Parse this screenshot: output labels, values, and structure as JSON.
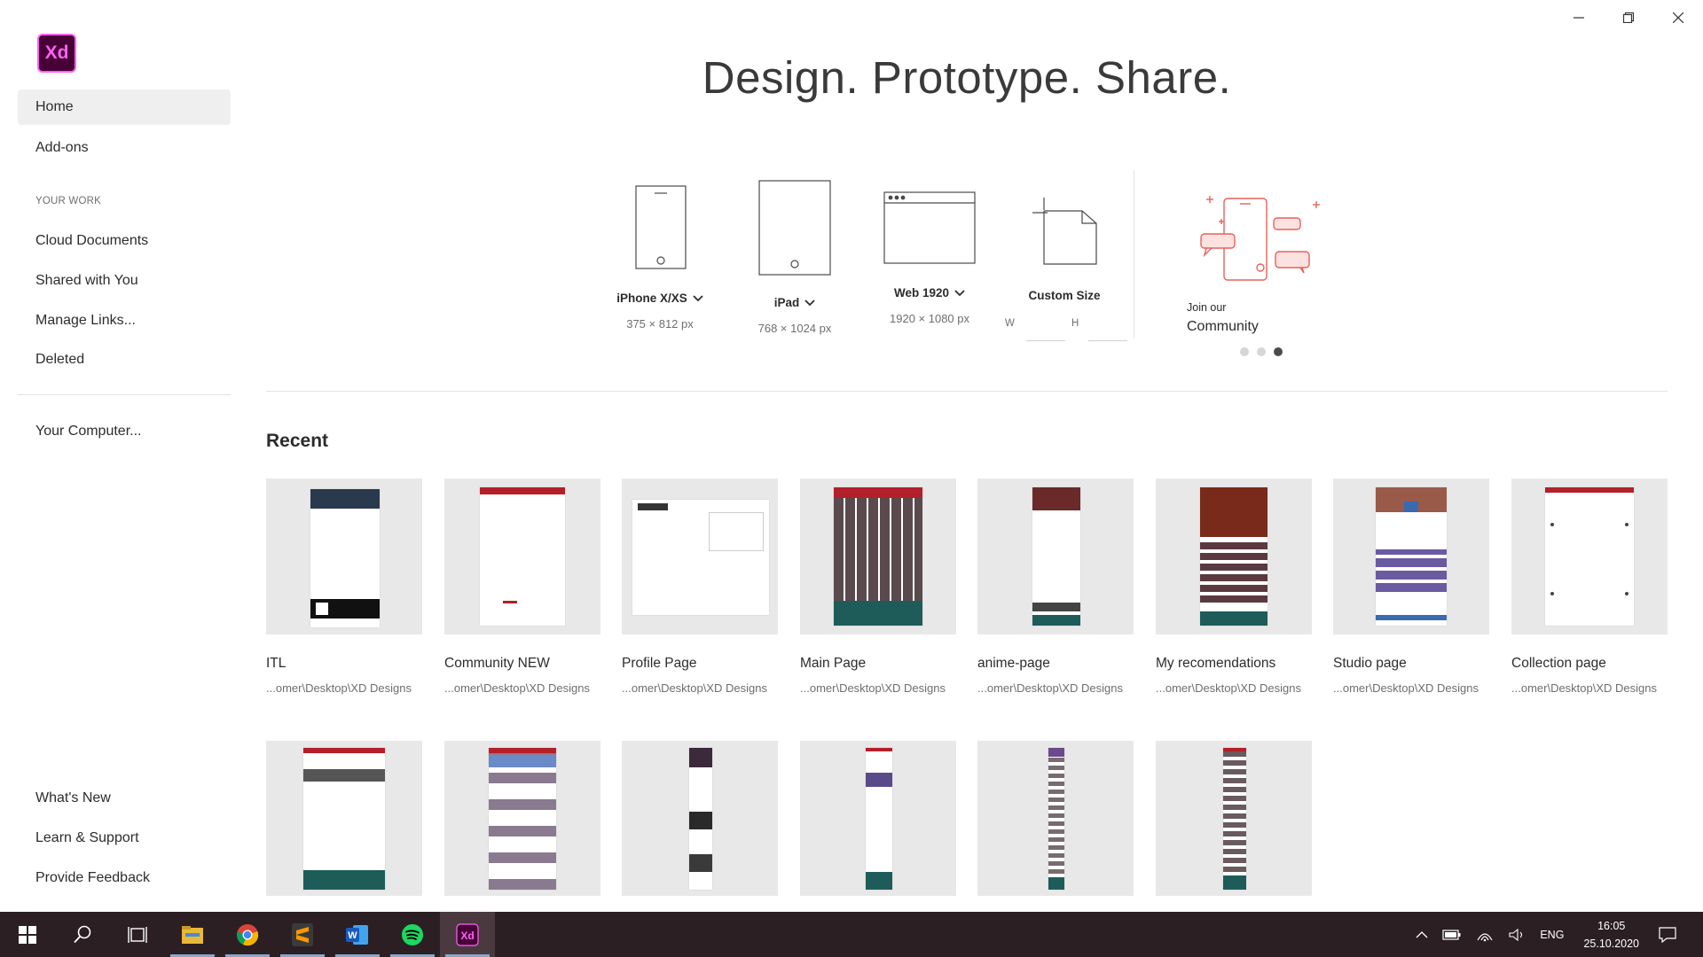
{
  "app": {
    "logo_text": "Xd",
    "brand_color": "#ff61f6",
    "brand_bg": "#470137"
  },
  "window_controls": [
    "minimize-icon",
    "restore-icon",
    "close-icon"
  ],
  "sidebar": {
    "items_top": [
      {
        "label": "Home",
        "active": true
      },
      {
        "label": "Add-ons"
      }
    ],
    "section_label": "YOUR WORK",
    "items_work": [
      {
        "label": "Cloud Documents"
      },
      {
        "label": "Shared with You"
      },
      {
        "label": "Manage Links..."
      },
      {
        "label": "Deleted"
      }
    ],
    "computer": "Your Computer...",
    "items_bottom": [
      {
        "label": "What's New"
      },
      {
        "label": "Learn & Support"
      },
      {
        "label": "Provide Feedback"
      }
    ]
  },
  "hero": {
    "title": "Design. Prototype. Share."
  },
  "presets": [
    {
      "name": "iPhone X/XS",
      "dims": "375 × 812 px",
      "icon": "phone-icon"
    },
    {
      "name": "iPad",
      "dims": "768 × 1024 px",
      "icon": "tablet-icon"
    },
    {
      "name": "Web 1920",
      "dims": "1920 × 1080 px",
      "icon": "browser-window-icon"
    }
  ],
  "custom_size": {
    "name": "Custom Size",
    "w_label": "W",
    "h_label": "H",
    "w_value": "",
    "h_value": ""
  },
  "community": {
    "small": "Join our",
    "big": "Community",
    "accent": "#e8605a"
  },
  "carousel": {
    "count": 3,
    "active": 3
  },
  "recent": {
    "title": "Recent",
    "cards": [
      {
        "title": "ITL",
        "path": "...omer\\Desktop\\XD Designs"
      },
      {
        "title": "Community NEW",
        "path": "...omer\\Desktop\\XD Designs"
      },
      {
        "title": "Profile Page",
        "path": "...omer\\Desktop\\XD Designs"
      },
      {
        "title": "Main Page",
        "path": "...omer\\Desktop\\XD Designs"
      },
      {
        "title": "anime-page",
        "path": "...omer\\Desktop\\XD Designs"
      },
      {
        "title": "My recomendations",
        "path": "...omer\\Desktop\\XD Designs"
      },
      {
        "title": "Studio page",
        "path": "...omer\\Desktop\\XD Designs"
      },
      {
        "title": "Collection page",
        "path": "...omer\\Desktop\\XD Designs"
      }
    ],
    "row2_count": 6
  },
  "taskbar": {
    "apps": [
      "windows-start-icon",
      "search-icon",
      "task-view-icon",
      "file-explorer-icon",
      "chrome-icon",
      "sublime-text-icon",
      "word-icon",
      "spotify-icon",
      "adobe-xd-icon"
    ],
    "lang": "ENG",
    "time": "16:05",
    "date": "25.10.2020"
  }
}
